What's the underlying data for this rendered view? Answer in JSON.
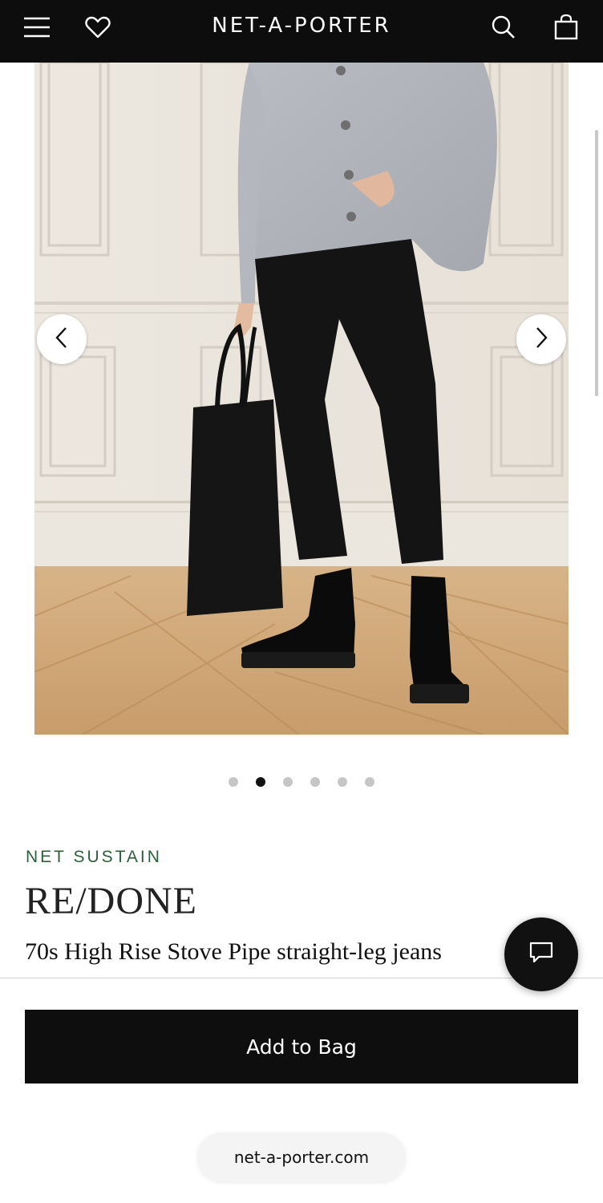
{
  "header": {
    "logo": "NET-A-PORTER",
    "menu_icon": "hamburger-menu-icon",
    "wishlist_icon": "heart-icon",
    "search_icon": "search-icon",
    "bag_icon": "shopping-bag-icon"
  },
  "gallery": {
    "image_alt": "Model wearing RE/DONE 70s High Rise Stove Pipe straight-leg jeans with grey cardigan, black tote and black boots",
    "prev_icon": "chevron-left-icon",
    "next_icon": "chevron-right-icon",
    "dot_count": 6,
    "active_dot": 2
  },
  "product": {
    "tag": "NET SUSTAIN",
    "brand": "RE/DONE",
    "name": "70s High Rise Stove Pipe straight-leg jeans"
  },
  "chat": {
    "icon": "chat-bubble-icon"
  },
  "cta": {
    "add_to_bag": "Add to Bag"
  },
  "browser": {
    "url": "net-a-porter.com"
  },
  "colors": {
    "header_bg": "#0d0d0d",
    "sustain_green": "#2e5e3a",
    "cta_bg": "#0e0e0e"
  }
}
